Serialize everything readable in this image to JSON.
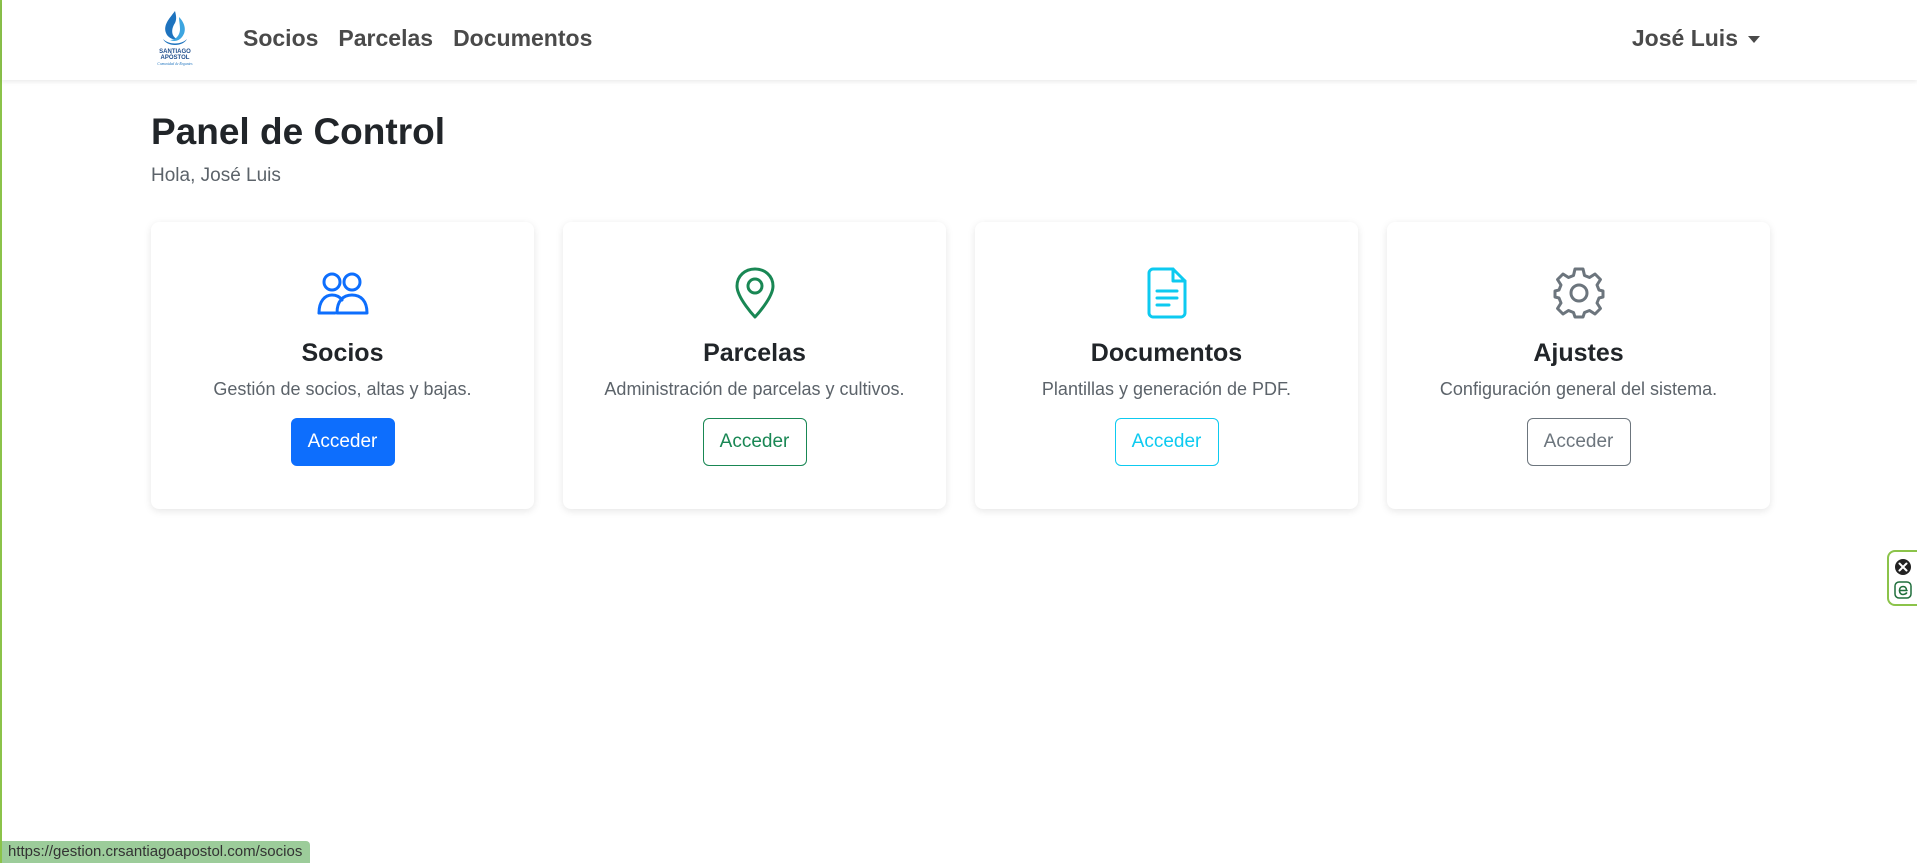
{
  "nav": {
    "logo_alt": "SANTIAGO APÓSTOL",
    "logo_text_line1": "SANTIAGO",
    "logo_text_line2": "APÓSTOL",
    "logo_text_line3": "Comunidad de Regantes",
    "links": [
      "Socios",
      "Parcelas",
      "Documentos"
    ],
    "user_name": "José Luis"
  },
  "main": {
    "title": "Panel de Control",
    "greeting": "Hola, José Luis",
    "cards": [
      {
        "title": "Socios",
        "description": "Gestión de socios, altas y bajas.",
        "button": "Acceder",
        "icon": "users-icon",
        "color": "#0d6efd"
      },
      {
        "title": "Parcelas",
        "description": "Administración de parcelas y cultivos.",
        "button": "Acceder",
        "icon": "map-pin-icon",
        "color": "#198754"
      },
      {
        "title": "Documentos",
        "description": "Plantillas y generación de PDF.",
        "button": "Acceder",
        "icon": "document-icon",
        "color": "#0dcaf0"
      },
      {
        "title": "Ajustes",
        "description": "Configuración general del sistema.",
        "button": "Acceder",
        "icon": "gear-icon",
        "color": "#6c757d"
      }
    ]
  },
  "status_bar": {
    "url": "https://gestion.crsantiagoapostol.com/socios"
  },
  "extension": {
    "icons": [
      "close-circle-icon",
      "e-icon"
    ],
    "color": "#8bc34a"
  }
}
